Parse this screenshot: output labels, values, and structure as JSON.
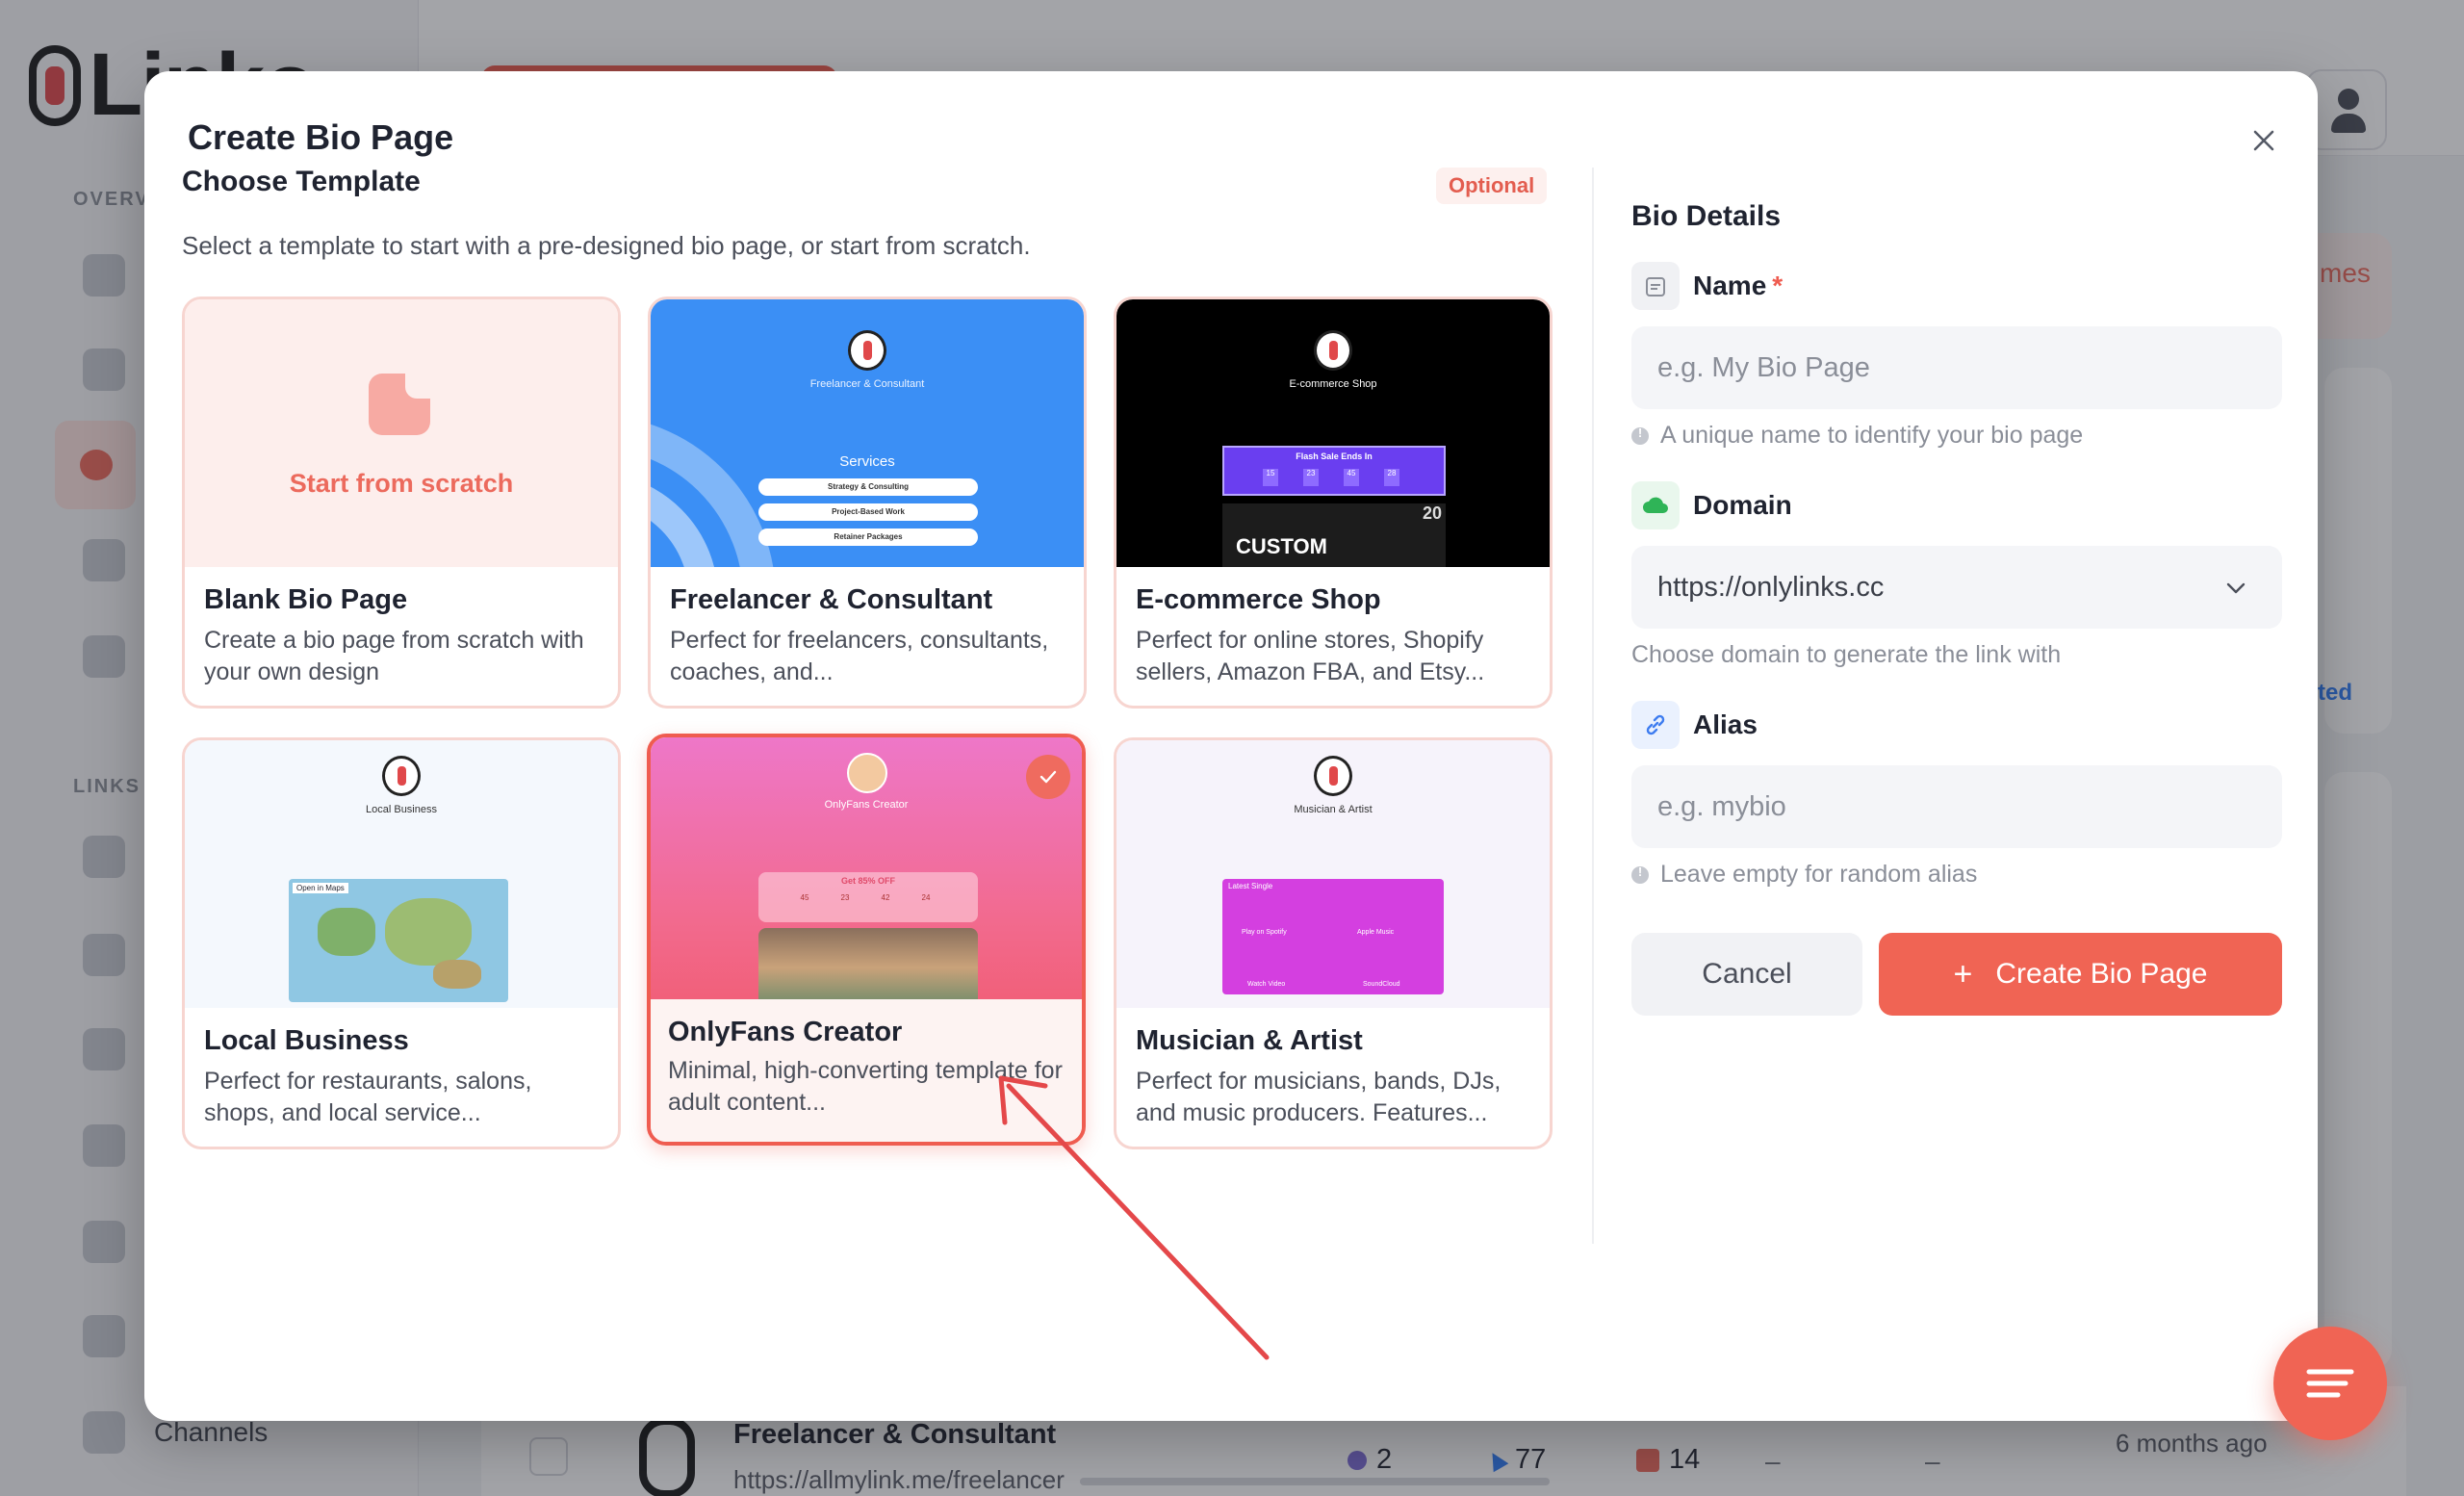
{
  "app": {
    "logo_text": "Linko",
    "sidebar": {
      "section_overview": "OVERV",
      "section_links": "LINKS",
      "bottom_item": "Channels"
    },
    "peek_right_1": "mes",
    "peek_right_2": "ted",
    "bg_row": {
      "title": "Freelancer & Consultant",
      "url": "https://allmylink.me/freelancer",
      "stat_views": "2",
      "stat_clicks": "77",
      "stat_count": "14",
      "dash1": "–",
      "dash2": "–",
      "date": "6 months ago"
    }
  },
  "modal": {
    "title": "Create Bio Page",
    "close_label": "×",
    "template_section": {
      "title": "Choose Template",
      "badge": "Optional",
      "description": "Select a template to start with a pre-designed bio page, or start from scratch."
    },
    "templates": [
      {
        "name": "Blank Bio Page",
        "desc": "Create a bio page from scratch with your own design",
        "cta": "Start from scratch"
      },
      {
        "name": "Freelancer & Consultant",
        "desc": "Perfect for freelancers, consultants, coaches, and...",
        "preview": {
          "title": "Freelancer & Consultant",
          "section": "Services",
          "items": [
            "Strategy & Consulting",
            "Project-Based Work",
            "Retainer Packages"
          ]
        }
      },
      {
        "name": "E-commerce Shop",
        "desc": "Perfect for online stores, Shopify sellers, Amazon FBA, and Etsy...",
        "preview": {
          "title": "E-commerce Shop",
          "banner": "Flash Sale Ends In",
          "counters": [
            "15",
            "23",
            "45",
            "28"
          ],
          "hero": "CUSTOM",
          "hero_num": "20"
        }
      },
      {
        "name": "Local Business",
        "desc": "Perfect for restaurants, salons, shops, and local service...",
        "preview": {
          "title": "Local Business",
          "map_label": "Open in Maps"
        }
      },
      {
        "name": "OnlyFans Creator",
        "desc": "Minimal, high-converting template for adult content...",
        "preview": {
          "title": "OnlyFans Creator",
          "offer": "Get 85% OFF",
          "counters": [
            "45",
            "23",
            "42",
            "24"
          ]
        }
      },
      {
        "name": "Musician & Artist",
        "desc": "Perfect for musicians, bands, DJs, and music producers. Features...",
        "preview": {
          "title": "Musician & Artist",
          "panel_title": "Latest Single",
          "buttons": [
            "Play on Spotify",
            "Apple Music",
            "Watch Video",
            "SoundCloud"
          ]
        }
      }
    ],
    "selected_template_index": 4,
    "details": {
      "title": "Bio Details",
      "name_label": "Name",
      "name_required": "*",
      "name_placeholder": "e.g. My Bio Page",
      "name_hint": "A unique name to identify your bio page",
      "domain_label": "Domain",
      "domain_value": "https://onlylinks.cc",
      "domain_hint": "Choose domain to generate the link with",
      "alias_label": "Alias",
      "alias_placeholder": "e.g. mybio",
      "alias_hint": "Leave empty for random alias",
      "cancel_label": "Cancel",
      "create_label": "Create Bio Page",
      "create_icon": "+"
    }
  },
  "colors": {
    "accent": "#f06454",
    "accent_soft": "#fdeeec",
    "annotation_arrow": "#e4484a"
  }
}
